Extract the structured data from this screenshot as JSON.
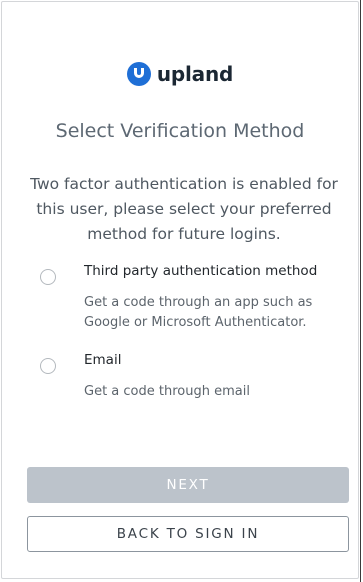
{
  "brand": {
    "name": "upland",
    "color": "#1f6fd6"
  },
  "title": "Select Verification Method",
  "intro": "Two factor authentication is enabled for this user, please select your preferred method for future logins.",
  "options": [
    {
      "label": "Third party authentication method",
      "description": "Get a code through an app such as Google or Microsoft Authenticator.",
      "selected": false
    },
    {
      "label": "Email",
      "description": "Get a code through email",
      "selected": false
    }
  ],
  "buttons": {
    "next_label": "NEXT",
    "next_enabled": false,
    "back_label": "BACK TO SIGN IN"
  }
}
